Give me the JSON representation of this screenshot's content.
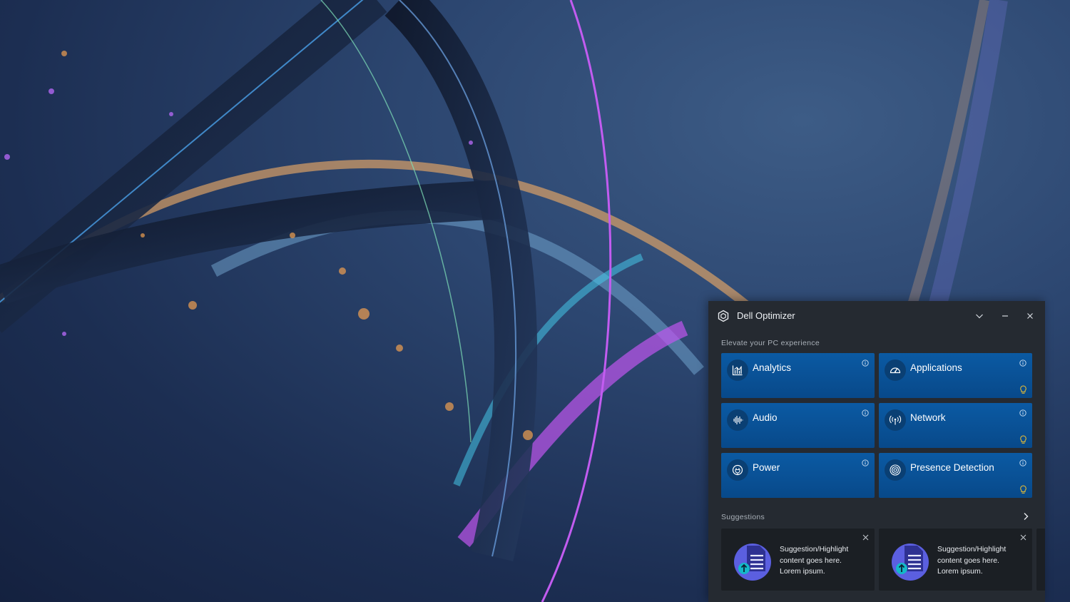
{
  "window": {
    "title": "Dell Optimizer",
    "icons": {
      "logo": "dell-optimizer-logo-icon",
      "collapse": "chevron-down-icon",
      "minimize": "minimize-icon",
      "close": "close-icon"
    }
  },
  "main": {
    "heading": "Elevate your PC experience",
    "tiles": [
      {
        "label": "Analytics",
        "icon": "analytics-chart-icon",
        "tip": false
      },
      {
        "label": "Applications",
        "icon": "speedometer-icon",
        "tip": true
      },
      {
        "label": "Audio",
        "icon": "audio-waveform-icon",
        "tip": false
      },
      {
        "label": "Network",
        "icon": "network-antenna-icon",
        "tip": true
      },
      {
        "label": "Power",
        "icon": "power-plug-icon",
        "tip": false
      },
      {
        "label": "Presence Detection",
        "icon": "presence-detection-icon",
        "tip": true
      }
    ]
  },
  "suggestions": {
    "heading": "Suggestions",
    "cards": [
      {
        "text_line1": "Suggestion/Highlight",
        "text_line2": "content goes here.",
        "text_line3": "Lorem ipsum."
      },
      {
        "text_line1": "Suggestion/Highlight",
        "text_line2": "content goes here.",
        "text_line3": "Lorem ipsum."
      }
    ]
  },
  "colors": {
    "panel_bg": "#252a31",
    "tile_blue": "#0b5aa3",
    "card_bg": "#1b1f24",
    "tip_bulb": "#f2c230",
    "accent_purple": "#5b5fe0",
    "accent_teal": "#14b8c8"
  }
}
